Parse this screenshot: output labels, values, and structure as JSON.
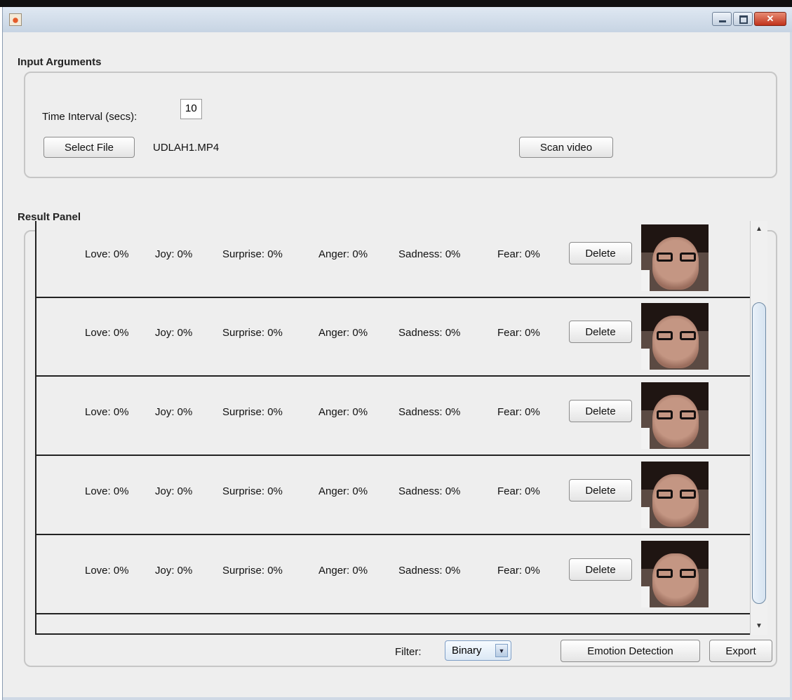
{
  "window": {
    "title": "",
    "controls": [
      "minimize-icon",
      "maximize-icon",
      "close-icon"
    ]
  },
  "input_arguments": {
    "title": "Input Arguments",
    "time_interval_label": "Time Interval (secs):",
    "time_interval_value": "10",
    "select_file_label": "Select File",
    "file_name": "UDLAH1.MP4",
    "scan_video_label": "Scan video"
  },
  "result_panel": {
    "title": "Result Panel",
    "rows": [
      {
        "love": "Love: 0%",
        "joy": "Joy: 0%",
        "surprise": "Surprise: 0%",
        "anger": "Anger: 0%",
        "sadness": "Sadness: 0%",
        "fear": "Fear: 0%",
        "delete_label": "Delete"
      },
      {
        "love": "Love: 0%",
        "joy": "Joy: 0%",
        "surprise": "Surprise: 0%",
        "anger": "Anger: 0%",
        "sadness": "Sadness: 0%",
        "fear": "Fear: 0%",
        "delete_label": "Delete"
      },
      {
        "love": "Love: 0%",
        "joy": "Joy: 0%",
        "surprise": "Surprise: 0%",
        "anger": "Anger: 0%",
        "sadness": "Sadness: 0%",
        "fear": "Fear: 0%",
        "delete_label": "Delete"
      },
      {
        "love": "Love: 0%",
        "joy": "Joy: 0%",
        "surprise": "Surprise: 0%",
        "anger": "Anger: 0%",
        "sadness": "Sadness: 0%",
        "fear": "Fear: 0%",
        "delete_label": "Delete"
      },
      {
        "love": "Love: 0%",
        "joy": "Joy: 0%",
        "surprise": "Surprise: 0%",
        "anger": "Anger: 0%",
        "sadness": "Sadness: 0%",
        "fear": "Fear: 0%",
        "delete_label": "Delete"
      }
    ]
  },
  "footer": {
    "filter_label": "Filter:",
    "filter_value": "Binary",
    "emotion_detection_label": "Emotion Detection",
    "export_label": "Export"
  }
}
